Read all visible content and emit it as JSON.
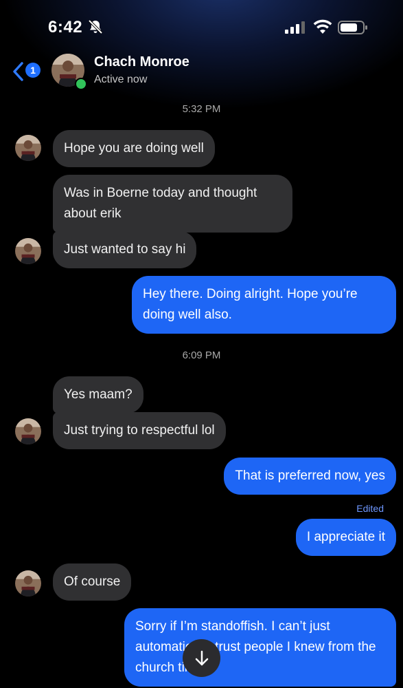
{
  "status_bar": {
    "time": "6:42"
  },
  "header": {
    "back_badge": "1",
    "contact_name": "Chach Monroe",
    "contact_status": "Active now"
  },
  "timestamps": [
    "5:32 PM",
    "6:09 PM"
  ],
  "messages": [
    {
      "side": "incoming",
      "text": "Hope you are doing well"
    },
    {
      "side": "incoming",
      "text": "Was in Boerne today and thought about erik"
    },
    {
      "side": "incoming",
      "text": "Just wanted to say hi"
    },
    {
      "side": "outgoing",
      "text": "Hey there. Doing alright. Hope you’re doing well also."
    },
    {
      "side": "incoming",
      "text": "Yes maam?"
    },
    {
      "side": "incoming",
      "text": "Just trying to respectful lol"
    },
    {
      "side": "outgoing",
      "text": "That is preferred now, yes"
    },
    {
      "side": "outgoing",
      "text": "I appreciate it",
      "edited_label": "Edited"
    },
    {
      "side": "incoming",
      "text": "Of course"
    },
    {
      "side": "outgoing",
      "text": "Sorry if I’m standoffish. I can’t just automatically trust people I knew from the church times"
    }
  ],
  "icons": {
    "back": "chevron-left-icon",
    "silent": "bell-slash-icon",
    "signal": "cellular-signal-icon",
    "wifi": "wifi-icon",
    "battery": "battery-icon",
    "scroll": "arrow-down-icon"
  },
  "colors": {
    "accent": "#1e66f5",
    "incoming_bubble": "#303032",
    "online": "#31c35a",
    "edited": "#6e97ff"
  }
}
